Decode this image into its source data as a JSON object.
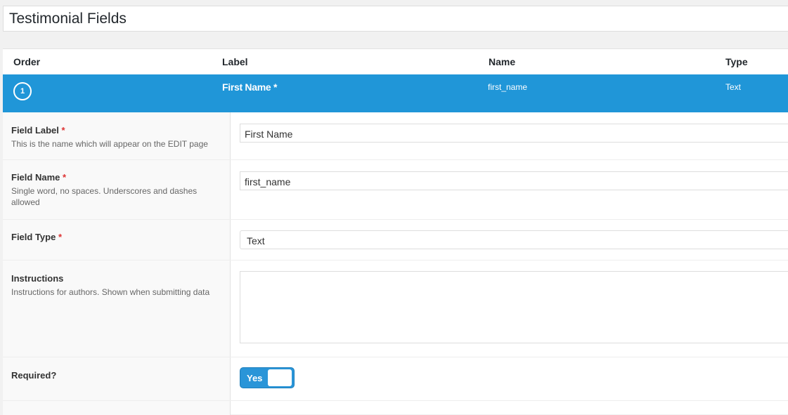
{
  "page": {
    "title": "Testimonial Fields"
  },
  "table": {
    "headers": {
      "order": "Order",
      "label": "Label",
      "name": "Name",
      "type": "Type"
    },
    "active_field": {
      "order": "1",
      "label": "First Name *",
      "name": "first_name",
      "type": "Text"
    }
  },
  "settings": {
    "field_label": {
      "label": "Field Label",
      "required_mark": "*",
      "description": "This is the name which will appear on the EDIT page",
      "value": "First Name"
    },
    "field_name": {
      "label": "Field Name",
      "required_mark": "*",
      "description": "Single word, no spaces. Underscores and dashes allowed",
      "value": "first_name"
    },
    "field_type": {
      "label": "Field Type",
      "required_mark": "*",
      "value": "Text"
    },
    "instructions": {
      "label": "Instructions",
      "description": "Instructions for authors. Shown when submitting data",
      "value": ""
    },
    "required": {
      "label": "Required?",
      "toggle_label": "Yes",
      "toggle_on": true
    }
  },
  "colors": {
    "accent": "#2096d8",
    "required_mark": "#dd3333"
  }
}
